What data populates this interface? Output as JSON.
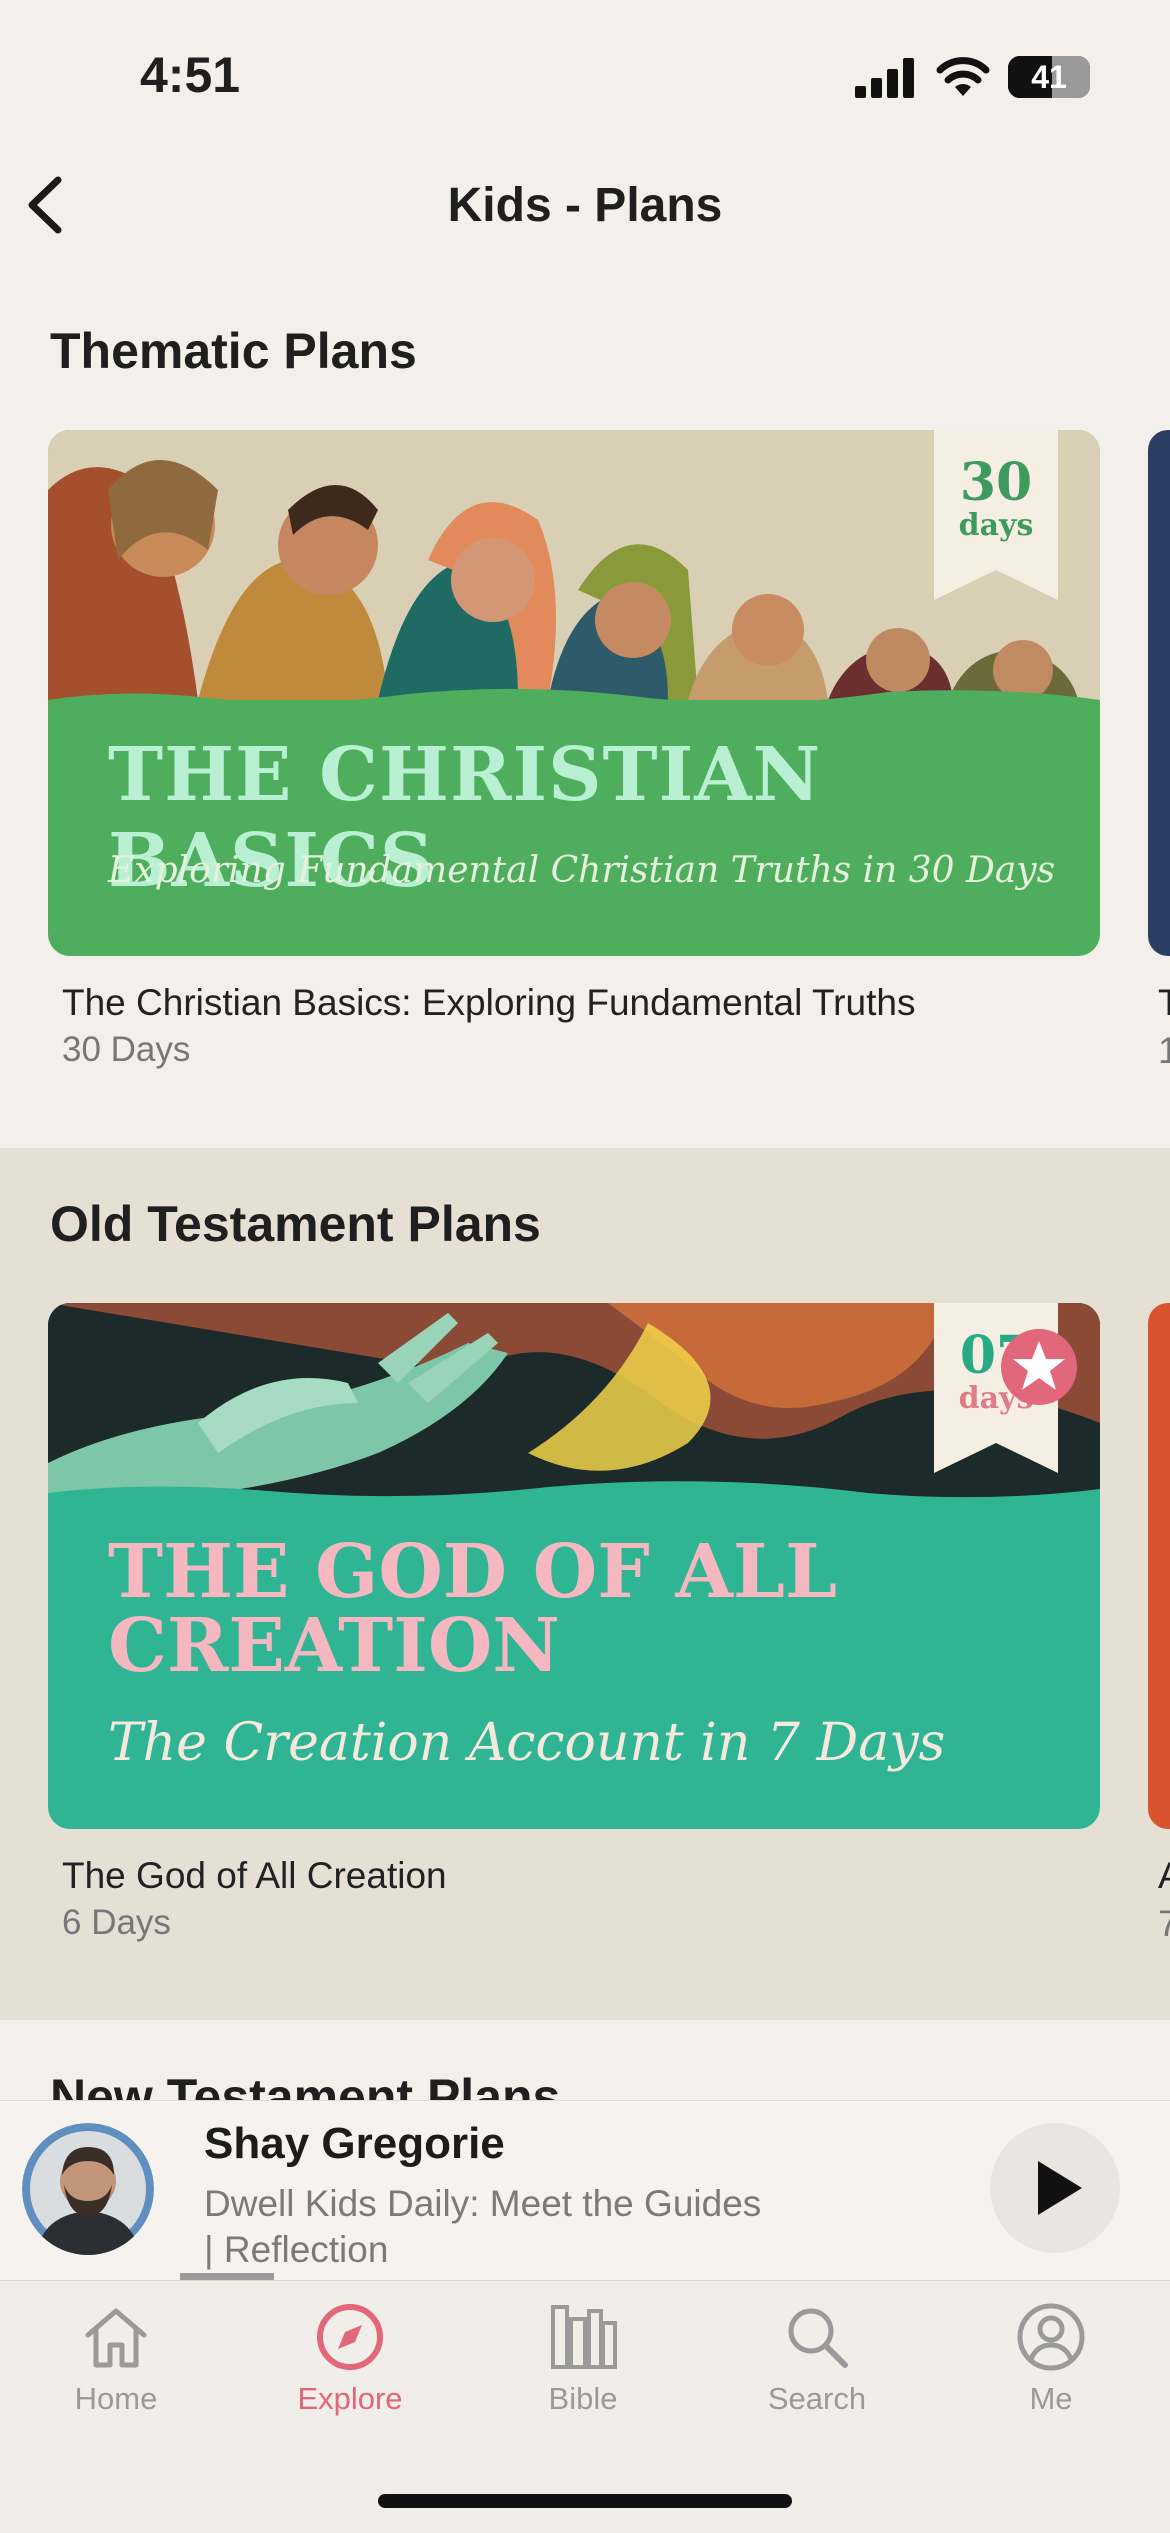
{
  "status_bar": {
    "time": "4:51",
    "battery": "41"
  },
  "header": {
    "title": "Kids - Plans"
  },
  "sections": [
    {
      "title": "Thematic Plans",
      "card": {
        "image_title": "THE CHRISTIAN BASICS",
        "image_subtitle": "Exploring Fundamental Christian Truths in 30 Days",
        "ribbon_number": "30",
        "ribbon_days": "days",
        "title": "The Christian Basics: Exploring Fundamental Truths",
        "duration": "30 Days"
      },
      "peek_title": "T",
      "peek_sub": "1"
    },
    {
      "title": "Old Testament Plans",
      "card": {
        "image_title_line1": "THE GOD OF ALL",
        "image_title_line2": "CREATION",
        "image_subtitle": "The Creation Account in 7 Days",
        "ribbon_number": "07",
        "ribbon_days": "days",
        "title": "The God of All Creation",
        "duration": "6 Days"
      },
      "peek_title": "A",
      "peek_sub": "7"
    },
    {
      "title": "New Testament Plans"
    }
  ],
  "player": {
    "name": "Shay Gregorie",
    "line1": "Dwell Kids Daily: Meet the Guides",
    "line2": "| Reflection"
  },
  "tabs": [
    {
      "label": "Home",
      "icon": "home-icon"
    },
    {
      "label": "Explore",
      "icon": "compass-icon",
      "active": true
    },
    {
      "label": "Bible",
      "icon": "books-icon"
    },
    {
      "label": "Search",
      "icon": "search-icon"
    },
    {
      "label": "Me",
      "icon": "person-icon"
    }
  ],
  "colors": {
    "accent": "#e2677a",
    "card1_green": "#4fae5d",
    "card2_teal": "#2fb594"
  }
}
